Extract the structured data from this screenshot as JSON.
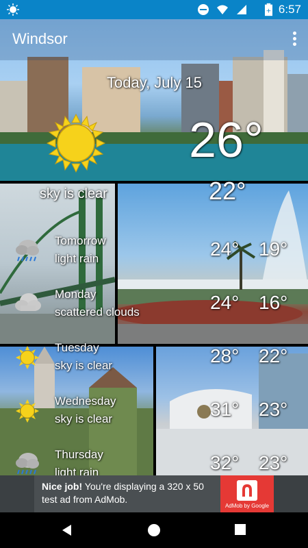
{
  "status_bar": {
    "time": "6:57",
    "icons": [
      "weather-app-icon",
      "do-not-disturb-icon",
      "wifi-icon",
      "signal-icon",
      "battery-icon"
    ]
  },
  "app_bar": {
    "city": "Windsor",
    "menu_icon": "more-vert-icon"
  },
  "today": {
    "date": "Today, July 15",
    "temp_high": "26°",
    "temp_low": "22°",
    "condition": "sky is clear",
    "icon": "sun-icon"
  },
  "forecast": [
    {
      "day": "Tomorrow",
      "condition": "light rain",
      "high": "24°",
      "low": "19°",
      "icon": "rain-cloud-icon"
    },
    {
      "day": "Monday",
      "condition": "scattered clouds",
      "high": "24°",
      "low": "16°",
      "icon": "cloud-icon"
    },
    {
      "day": "Tuesday",
      "condition": "sky is clear",
      "high": "28°",
      "low": "22°",
      "icon": "sun-icon"
    },
    {
      "day": "Wednesday",
      "condition": "sky is clear",
      "high": "31°",
      "low": "23°",
      "icon": "sun-icon"
    },
    {
      "day": "Thursday",
      "condition": "light rain",
      "high": "32°",
      "low": "23°",
      "icon": "rain-cloud-icon"
    }
  ],
  "ad": {
    "bold": "Nice job!",
    "text": " You're displaying a 320 x 50 test ad from AdMob.",
    "badge": "AdMob by Google"
  },
  "colors": {
    "status_bar": "#0a84c8",
    "ad_badge": "#e53935",
    "sun": "#f6d21b"
  }
}
